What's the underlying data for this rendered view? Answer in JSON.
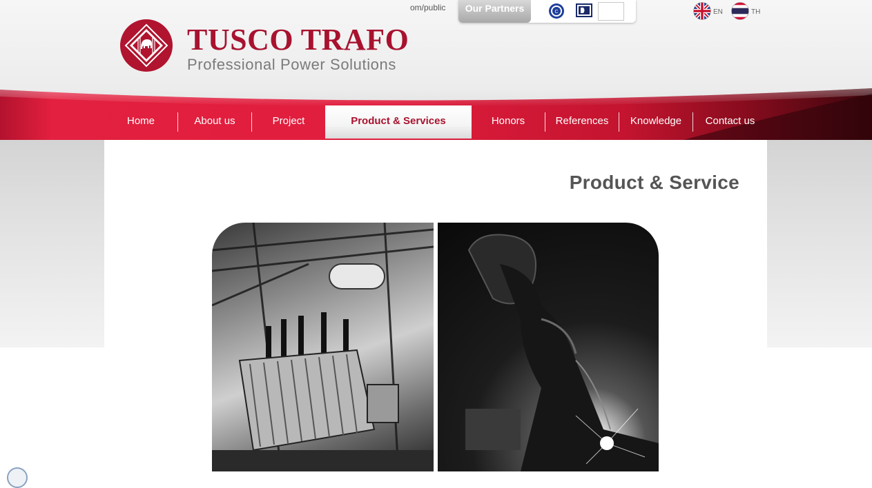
{
  "url_fragment": "om/public",
  "brand": {
    "name": "TUSCO  TRAFO",
    "tagline": "Professional Power Solutions",
    "colors": {
      "primary": "#a8122f",
      "dark_red": "#5a0a14",
      "nav_red": "#d8203e"
    }
  },
  "partners": {
    "label": "Our Partners",
    "logos": [
      "partner-logo-cirle-icon",
      "partner-logo-dk-icon",
      "partner-logo-blank"
    ]
  },
  "languages": [
    {
      "code": "EN",
      "icon": "uk-flag-icon"
    },
    {
      "code": "TH",
      "icon": "thai-flag-icon"
    }
  ],
  "nav": {
    "items": [
      {
        "label": "Home"
      },
      {
        "label": "About us"
      },
      {
        "label": "Project"
      },
      {
        "label": "Product & Services",
        "active": true
      },
      {
        "label": "Honors"
      },
      {
        "label": "References"
      },
      {
        "label": "Knowledge"
      },
      {
        "label": "Contact us"
      }
    ]
  },
  "content": {
    "title": "Product & Service",
    "images": [
      "transformer-photo",
      "welder-photo"
    ]
  }
}
